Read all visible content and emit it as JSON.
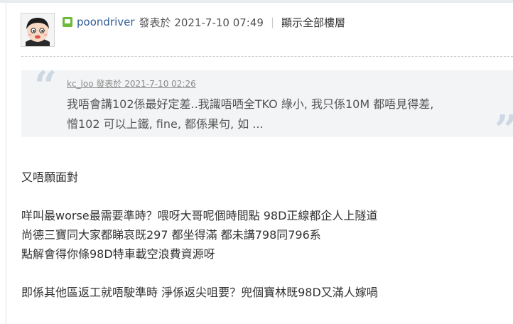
{
  "post": {
    "author": "poondriver",
    "posted_label": "發表於",
    "datetime": "2021-7-10 07:49",
    "separator": "|",
    "show_all_floors": "顯示全部樓層"
  },
  "quote": {
    "author": "kc_loo",
    "posted_label": "發表於",
    "datetime": "2021-7-10 02:26",
    "lines": [
      "我唔會講102係最好定差..我識唔哂全TKO 綠小, 我只係10M 都唔見得差,",
      "憎102 可以上鐵, fine, 都係果句, 如 ..."
    ]
  },
  "body": [
    "又唔願面對",
    "咩叫最worse最需要準時？喂呀大哥呢個時間點 98D正線都企人上隧道",
    "尚德三寶同大家都睇哀既297 都坐得滿 都未講798同796系",
    "點解會得你條98D特車載空浪費資源呀",
    "即係其他區返工就唔駛準時 淨係返尖咀要？兜個寶林既98D又滿人嫁喎"
  ]
}
